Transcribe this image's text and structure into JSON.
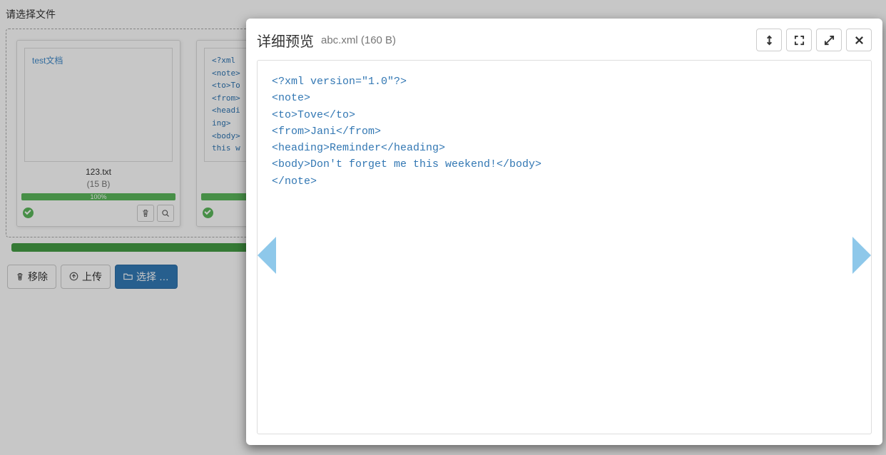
{
  "page": {
    "title": "请选择文件"
  },
  "files": [
    {
      "preview": "test文档",
      "name": "123.txt",
      "size": "(15 B)",
      "progress": "100%"
    },
    {
      "preview": "<?xml\n<note>\n<to>To\n<from>\n<heading>\n  Reminder\n<body>\nthis w",
      "name": "abc.xml",
      "size": "(160 B)",
      "progress": "100%"
    }
  ],
  "toolbar": {
    "remove": "移除",
    "upload": "上传",
    "select": "选择 …"
  },
  "modal": {
    "title": "详细预览",
    "filename": "abc.xml",
    "size": "(160 B)",
    "content": "<?xml version=\"1.0\"?>\n<note>\n<to>Tove</to>\n<from>Jani</from>\n<heading>Reminder</heading>\n<body>Don't forget me this weekend!</body>\n</note>"
  }
}
